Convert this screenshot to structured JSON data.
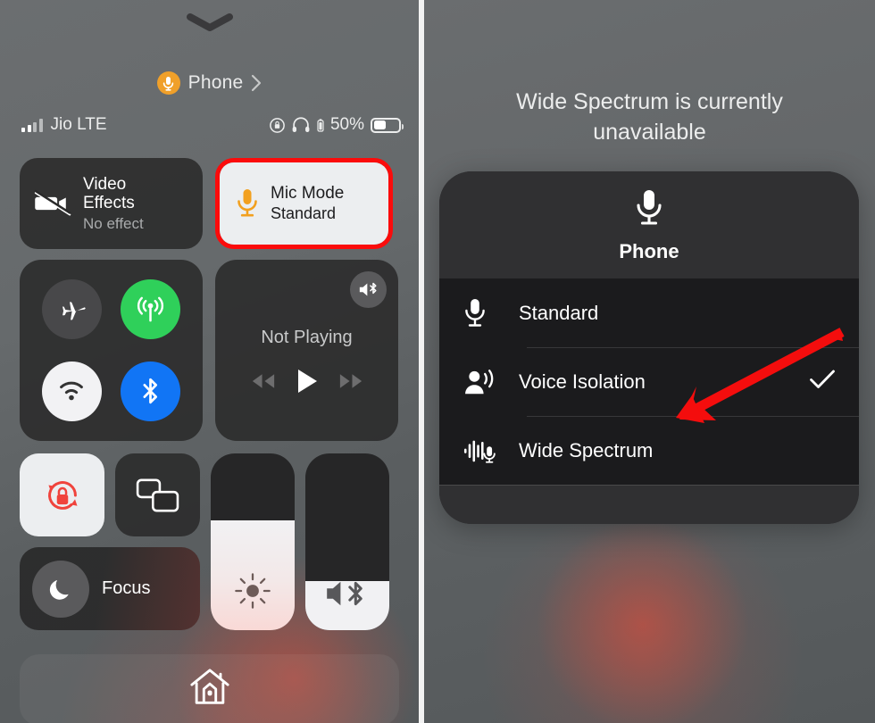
{
  "left": {
    "grabber": "chevron-down",
    "header": {
      "title": "Phone",
      "mic_icon": "microphone-icon",
      "chevron": "›"
    },
    "status": {
      "carrier": "Jio LTE",
      "signal_bars_filled": 2,
      "signal_bars_total": 4,
      "orientation_lock_icon": "rotation-lock-icon",
      "headphones_icon": "headphones-icon",
      "battery_percent": "50%",
      "battery_level": 50
    },
    "video_effects": {
      "title_line1": "Video",
      "title_line2": "Effects",
      "subtitle": "No effect",
      "icon": "video-slash-icon"
    },
    "mic_mode": {
      "title": "Mic Mode",
      "subtitle": "Standard",
      "icon": "microphone-icon",
      "highlight_color": "#fb0b0b",
      "card_color": "#eceef0"
    },
    "connectivity": {
      "airplane": {
        "name": "Airplane Mode",
        "icon": "airplane-icon",
        "active": false,
        "color": "#48484a"
      },
      "cellular": {
        "name": "Cellular Data",
        "icon": "cellular-antenna-icon",
        "active": true,
        "color": "#2fd05a"
      },
      "wifi": {
        "name": "Wi-Fi",
        "icon": "wifi-icon",
        "active": true,
        "color": "#f2f2f4"
      },
      "bluetooth": {
        "name": "Bluetooth",
        "icon": "bluetooth-icon",
        "active": true,
        "color": "#1175f5"
      }
    },
    "media": {
      "status": "Not Playing",
      "route_icon": "airplay-audio-bluetooth-icon",
      "rewind_icon": "rewind-icon",
      "play_icon": "play-icon",
      "forward_icon": "fast-forward-icon"
    },
    "rotation_lock": {
      "name": "Rotation Lock",
      "icon": "rotation-lock-icon",
      "active": true
    },
    "screen_mirroring": {
      "name": "Screen Mirroring",
      "icon": "screen-mirroring-icon",
      "active": false
    },
    "focus": {
      "label": "Focus",
      "icon": "moon-icon"
    },
    "brightness": {
      "name": "Brightness",
      "icon": "sun-icon",
      "value": 62
    },
    "volume": {
      "name": "Volume",
      "icon": "speaker-bluetooth-icon",
      "value": 28
    },
    "home": {
      "name": "Home",
      "icon": "home-icon"
    }
  },
  "right": {
    "banner": "Wide Spectrum is currently unavailable",
    "sheet": {
      "header_icon": "microphone-icon",
      "header_title": "Phone",
      "options": [
        {
          "label": "Standard",
          "icon": "microphone-icon",
          "selected": false
        },
        {
          "label": "Voice Isolation",
          "icon": "person-voice-icon",
          "selected": true
        },
        {
          "label": "Wide Spectrum",
          "icon": "waveform-microphone-icon",
          "selected": false
        }
      ],
      "check_glyph": "✓"
    },
    "annotation": {
      "type": "arrow",
      "color": "#f40d0d",
      "points_to": "Voice Isolation"
    }
  }
}
